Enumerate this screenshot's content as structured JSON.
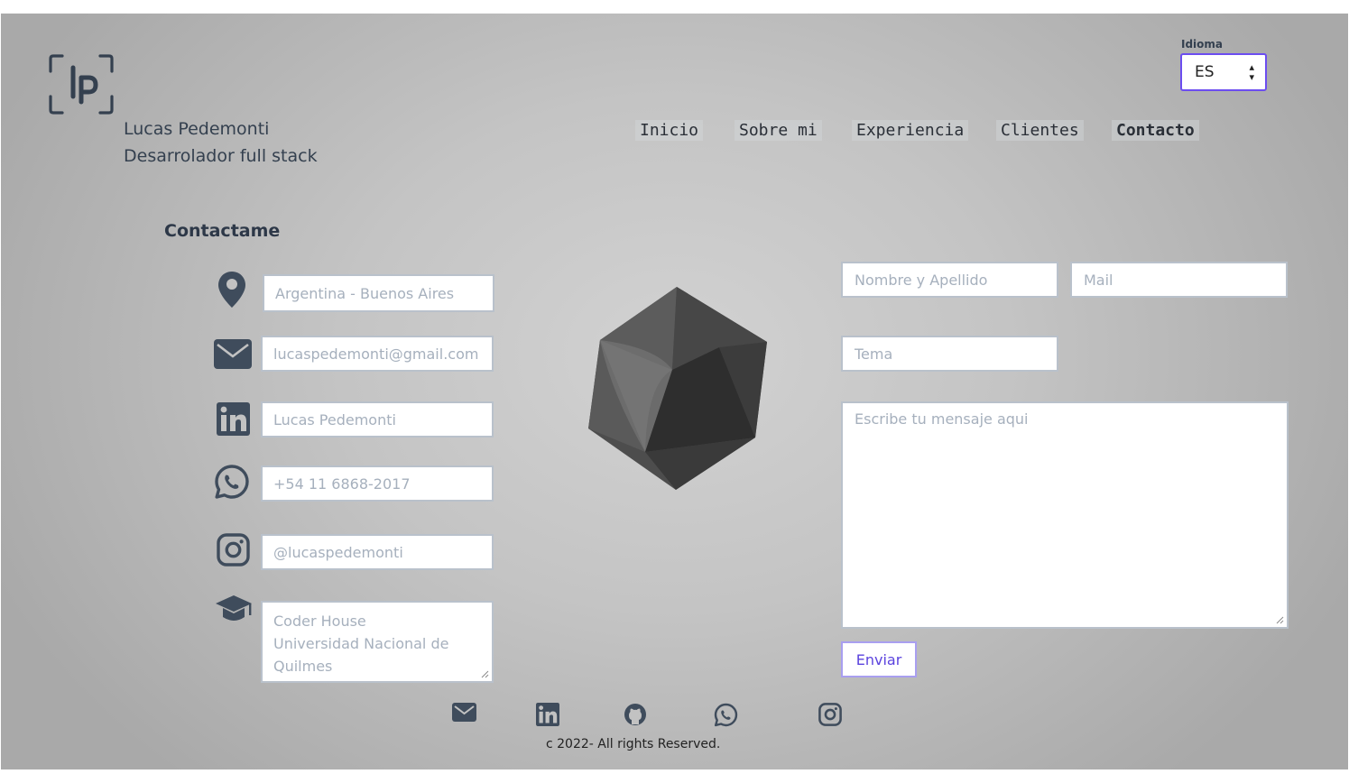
{
  "brand": {
    "logo_letters": "lp",
    "name": "Lucas Pedemonti",
    "role": "Desarrolador full stack"
  },
  "language": {
    "label": "Idioma",
    "selected": "ES"
  },
  "nav": {
    "items": [
      {
        "label": "Inicio"
      },
      {
        "label": "Sobre mi"
      },
      {
        "label": "Experiencia"
      },
      {
        "label": "Clientes"
      },
      {
        "label": "Contacto",
        "active": true
      }
    ]
  },
  "contact": {
    "title": "Contactame",
    "items": [
      {
        "icon": "location-pin-icon",
        "value": "Argentina - Buenos Aires"
      },
      {
        "icon": "mail-icon",
        "value": "lucaspedemonti@gmail.com"
      },
      {
        "icon": "linkedin-icon",
        "value": "Lucas Pedemonti"
      },
      {
        "icon": "whatsapp-icon",
        "value": "+54 11 6868-2017"
      },
      {
        "icon": "instagram-icon",
        "value": "@lucaspedemonti"
      },
      {
        "icon": "graduation-cap-icon",
        "value": "Coder House\nUniversidad Nacional de Quilmes",
        "lines": [
          "Coder House",
          "Universidad Nacional de",
          "Quilmes"
        ]
      }
    ]
  },
  "form": {
    "name_placeholder": "Nombre y Apellido",
    "mail_placeholder": "Mail",
    "subject_placeholder": "Tema",
    "message_placeholder": "Escribe tu mensaje aqui",
    "submit_label": "Enviar"
  },
  "footer": {
    "icons": [
      "mail-icon",
      "linkedin-icon",
      "github-icon",
      "whatsapp-icon",
      "instagram-icon"
    ],
    "copyright": "c 2022- All rights Reserved."
  },
  "colors": {
    "accent": "#6c4df0",
    "icon": "#3f4c5c",
    "text": "#34404f",
    "placeholder": "#a6b0bd"
  }
}
